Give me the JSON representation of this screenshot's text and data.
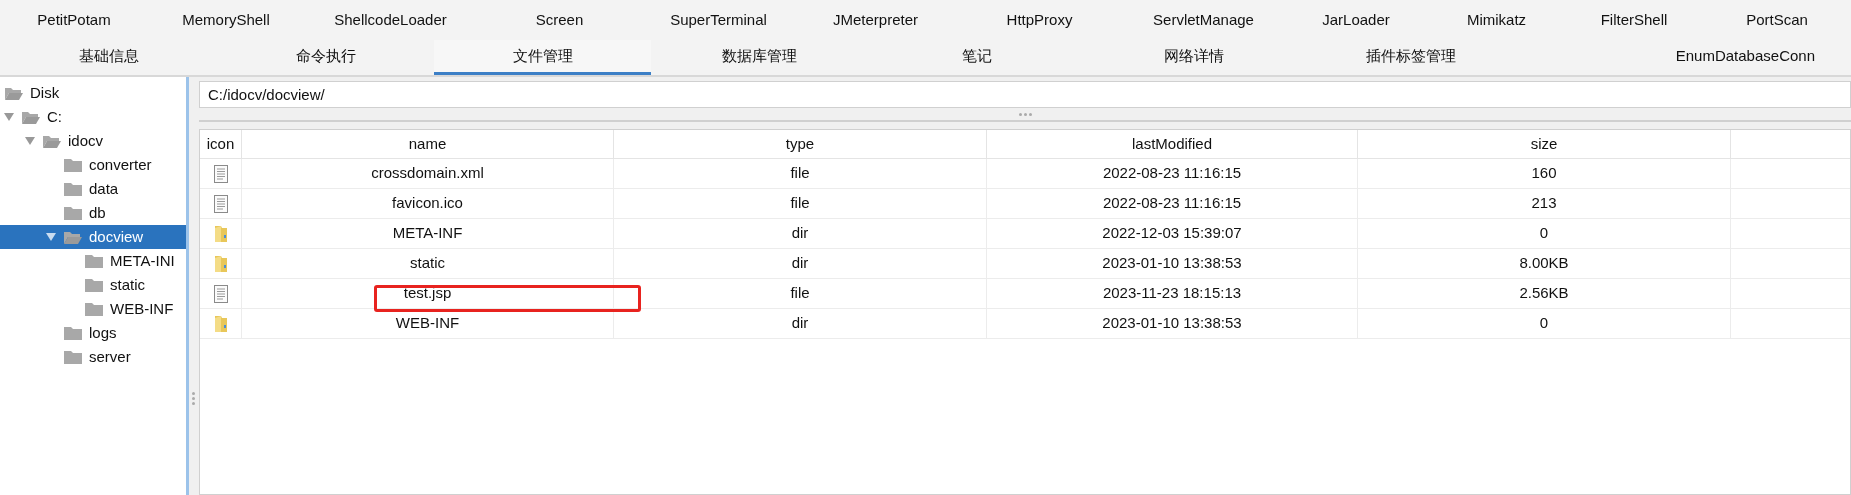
{
  "plugin_tabs": [
    {
      "label": "PetitPotam",
      "selected": false
    },
    {
      "label": "MemoryShell",
      "selected": false
    },
    {
      "label": "ShellcodeLoader",
      "selected": false
    },
    {
      "label": "Screen",
      "selected": false
    },
    {
      "label": "SuperTerminal",
      "selected": false
    },
    {
      "label": "JMeterpreter",
      "selected": false
    },
    {
      "label": "HttpProxy",
      "selected": false
    },
    {
      "label": "ServletManage",
      "selected": false
    },
    {
      "label": "JarLoader",
      "selected": false
    },
    {
      "label": "Mimikatz",
      "selected": false
    },
    {
      "label": "FilterShell",
      "selected": false
    },
    {
      "label": "PortScan",
      "selected": false
    }
  ],
  "tabs": [
    {
      "label": "基础信息",
      "selected": false
    },
    {
      "label": "命令执行",
      "selected": false
    },
    {
      "label": "文件管理",
      "selected": true
    },
    {
      "label": "数据库管理",
      "selected": false
    },
    {
      "label": "笔记",
      "selected": false
    },
    {
      "label": "网络详情",
      "selected": false
    },
    {
      "label": "插件标签管理",
      "selected": false
    },
    {
      "label": "EnumDatabaseConn",
      "selected": false
    }
  ],
  "tree": [
    {
      "label": "Disk",
      "expanded": true,
      "selected": false,
      "children": [
        {
          "label": "C:",
          "expanded": true,
          "selected": false,
          "children": [
            {
              "label": "idocv",
              "expanded": true,
              "selected": false,
              "children": [
                {
                  "label": "converter",
                  "expanded": false,
                  "selected": false
                },
                {
                  "label": "data",
                  "expanded": false,
                  "selected": false
                },
                {
                  "label": "db",
                  "expanded": false,
                  "selected": false
                },
                {
                  "label": "docview",
                  "expanded": true,
                  "selected": true,
                  "children": [
                    {
                      "label": "META-INI",
                      "expanded": false,
                      "selected": false
                    },
                    {
                      "label": "static",
                      "expanded": false,
                      "selected": false
                    },
                    {
                      "label": "WEB-INF",
                      "expanded": false,
                      "selected": false
                    }
                  ]
                },
                {
                  "label": "logs",
                  "expanded": false,
                  "selected": false
                },
                {
                  "label": "server",
                  "expanded": false,
                  "selected": false
                }
              ]
            }
          ]
        }
      ]
    }
  ],
  "path_field": {
    "value": "C:/idocv/docview/"
  },
  "table": {
    "columns": [
      "icon",
      "name",
      "type",
      "lastModified",
      "size"
    ],
    "rows": [
      {
        "kind": "file",
        "name": "crossdomain.xml",
        "type": "file",
        "lastModified": "2022-08-23 11:16:15",
        "size": "160",
        "highlighted": false
      },
      {
        "kind": "file",
        "name": "favicon.ico",
        "type": "file",
        "lastModified": "2022-08-23 11:16:15",
        "size": "213",
        "highlighted": false
      },
      {
        "kind": "dir",
        "name": "META-INF",
        "type": "dir",
        "lastModified": "2022-12-03 15:39:07",
        "size": "0",
        "highlighted": false
      },
      {
        "kind": "dir",
        "name": "static",
        "type": "dir",
        "lastModified": "2023-01-10 13:38:53",
        "size": "8.00KB",
        "highlighted": false
      },
      {
        "kind": "file",
        "name": "test.jsp",
        "type": "file",
        "lastModified": "2023-11-23 18:15:13",
        "size": "2.56KB",
        "highlighted": true
      },
      {
        "kind": "dir",
        "name": "WEB-INF",
        "type": "dir",
        "lastModified": "2023-01-10 13:38:53",
        "size": "0",
        "highlighted": false
      }
    ]
  }
}
